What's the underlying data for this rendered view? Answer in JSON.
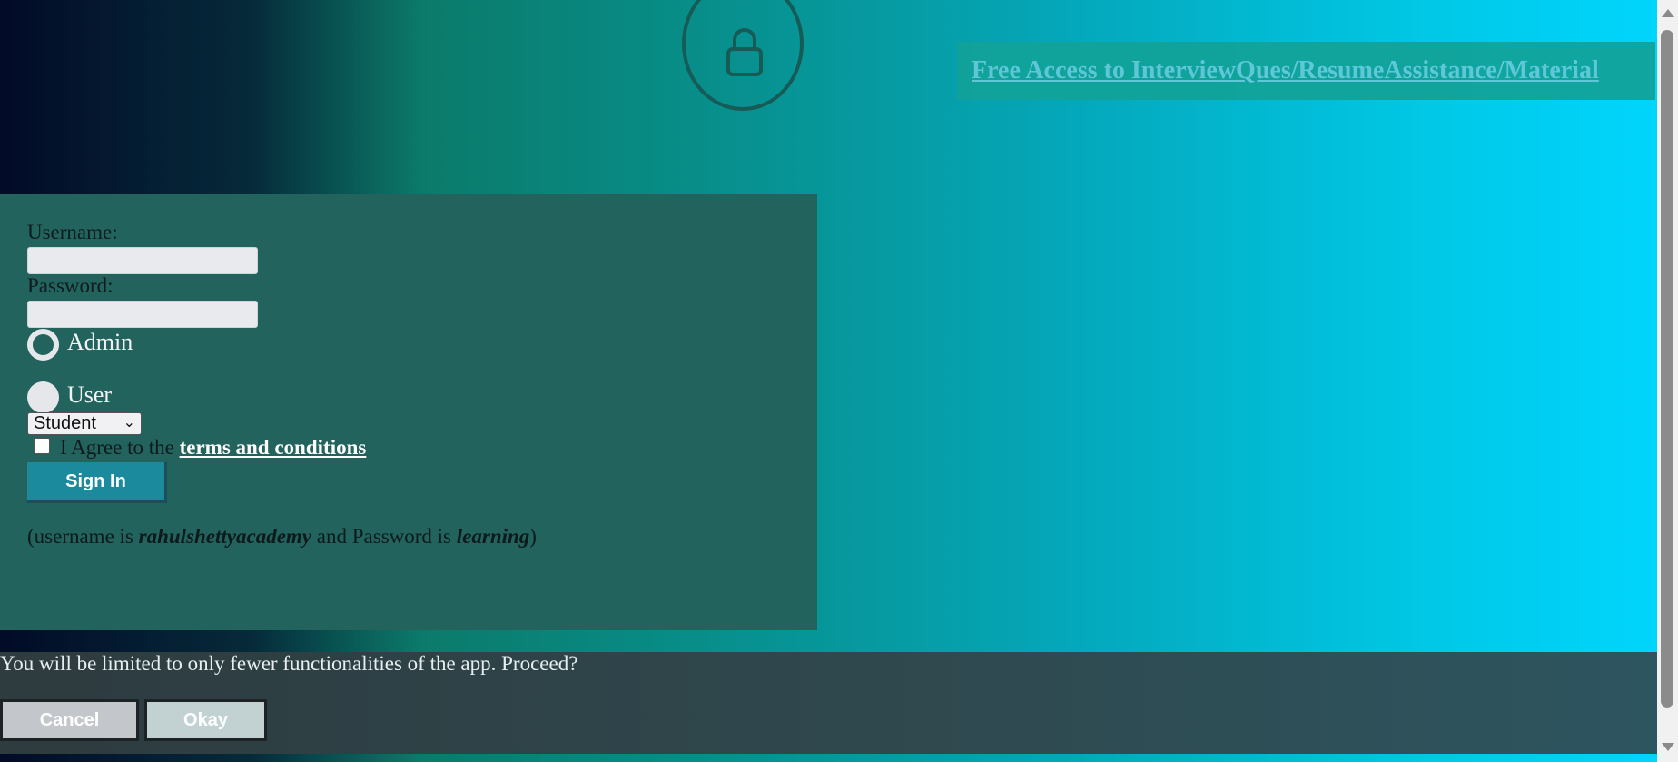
{
  "promo": {
    "link_text": "Free Access to InterviewQues/ResumeAssistance/Material"
  },
  "login": {
    "username_label": "Username:",
    "username_value": "",
    "password_label": "Password:",
    "password_value": "",
    "role_options": [
      {
        "label": "Admin",
        "selected": true
      },
      {
        "label": "User",
        "selected": false
      }
    ],
    "select_value": "Student",
    "agree_prefix": "I Agree to the ",
    "terms_link": "terms and conditions",
    "agree_checked": false,
    "signin_label": "Sign In",
    "hint": {
      "prefix": "(username is ",
      "username": "rahulshettyacademy",
      "middle": " and Password is ",
      "password": "learning",
      "suffix": ")"
    }
  },
  "modal": {
    "message": "You will be limited to only fewer functionalities of the app. Proceed?",
    "cancel_label": "Cancel",
    "okay_label": "Okay"
  },
  "colors": {
    "panel": "#22635d",
    "signin_button": "#1b8a9c",
    "promo_link": "#64c8d9"
  },
  "icons": {
    "lock": "lock-icon",
    "scroll_up": "arrow-up-icon",
    "scroll_down": "arrow-down-icon"
  }
}
